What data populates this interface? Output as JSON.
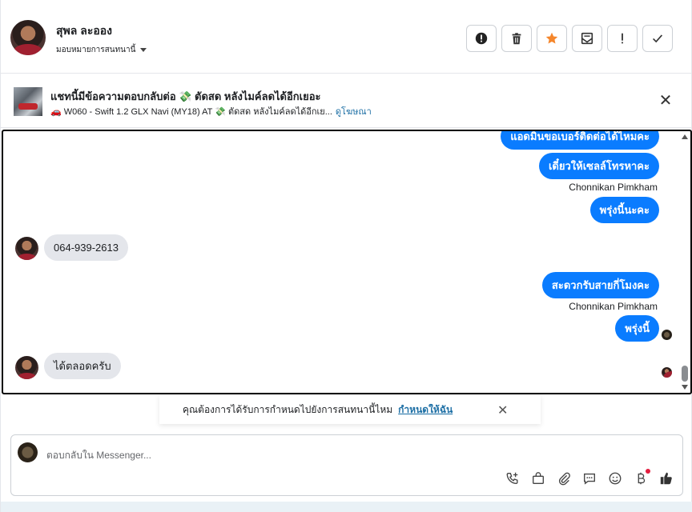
{
  "header": {
    "contact_name": "สุพล ละออง",
    "assign_label": "มอบหมายการสนทนานี้",
    "actions": [
      {
        "icon": "alert-circle-icon",
        "name": "spam"
      },
      {
        "icon": "trash-icon",
        "name": "delete"
      },
      {
        "icon": "star-icon",
        "name": "star"
      },
      {
        "icon": "mark-unread-icon",
        "name": "unread"
      },
      {
        "icon": "exclamation-icon",
        "name": "follow-up"
      },
      {
        "icon": "check-icon",
        "name": "done"
      }
    ],
    "star_color": "#f5862b"
  },
  "ad_banner": {
    "title": "แชทนี้มีข้อความตอบกลับต่อ 💸 ตัดสด หลังไมค์ลดได้อีกเยอะ",
    "subtitle": "🚗 W060 - Swift 1.2 GLX Navi (MY18) AT 💸 ตัดสด หลังไมค์ลดได้อีกเย...",
    "link": "ดูโฆษณา"
  },
  "messages": {
    "out_1": "แอดมินขอเบอร์ติดต่อได้ไหมคะ",
    "out_2": "เดี๋ยวให้เซลล์โทรหาคะ",
    "sender_1": "Chonnikan Pimkham",
    "out_3": "พรุ่งนี้นะคะ",
    "in_1": "064-939-2613",
    "out_4": "สะดวกรับสายกี่โมงคะ",
    "sender_2": "Chonnikan Pimkham",
    "out_5": "พรุ่งนี้",
    "in_2": "ได้ตลอดครับ"
  },
  "notice": {
    "text": "คุณต้องการได้รับการกำหนดไปยังการสนทนานี้ไหม",
    "link": "กำหนดให้ฉัน"
  },
  "composer": {
    "placeholder": "ตอบกลับใน Messenger...",
    "tools": [
      "phone-plus-icon",
      "shopping-bag-icon",
      "paperclip-icon",
      "saved-reply-icon",
      "emoji-icon",
      "baht-icon",
      "thumbs-up-icon"
    ]
  },
  "colors": {
    "outgoing_bubble": "#0a7cff",
    "incoming_bubble": "#e4e6eb",
    "link": "#1d6fa5"
  }
}
